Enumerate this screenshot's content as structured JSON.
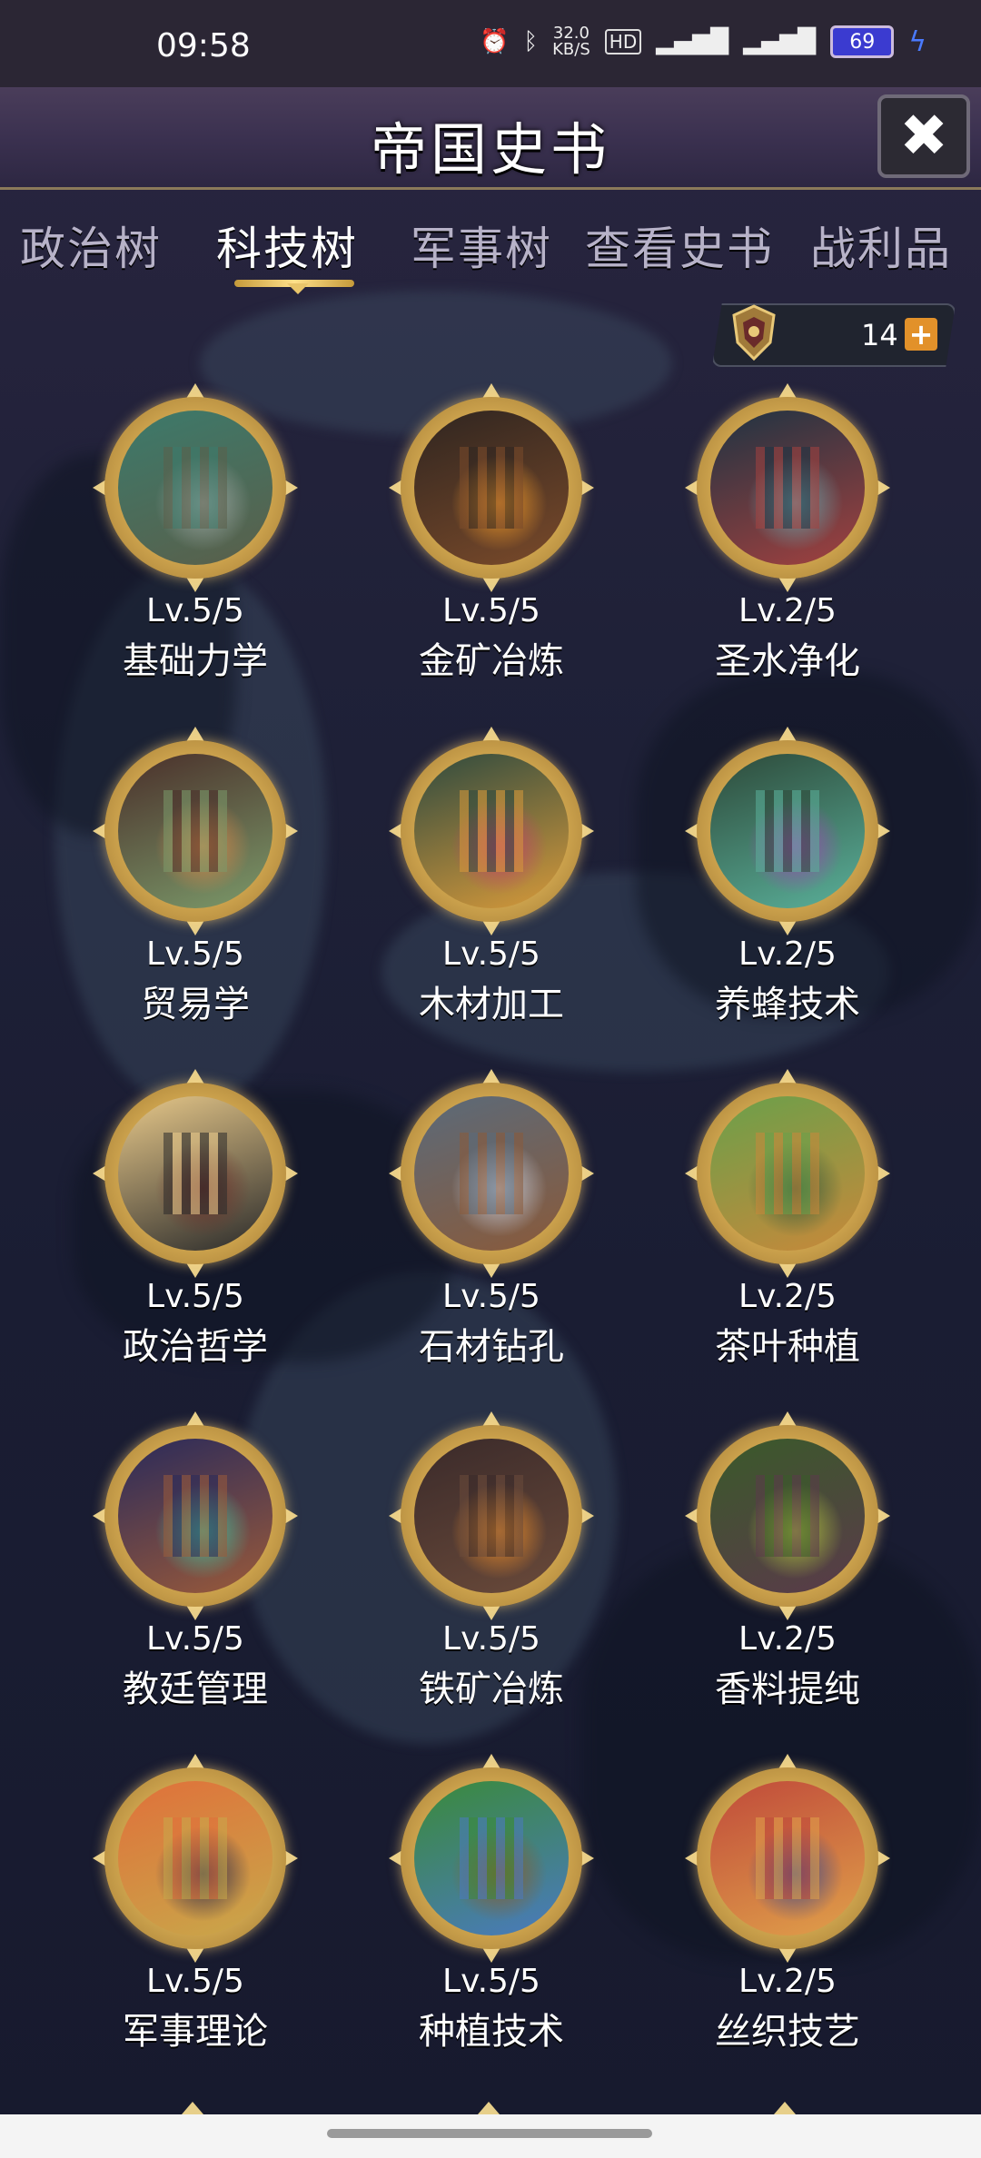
{
  "status": {
    "time": "09:58",
    "network_speed": "32.0\nKB/S",
    "battery": "69"
  },
  "header": {
    "title": "帝国史书",
    "close_label": "✖"
  },
  "tabs": [
    {
      "label": "政治树",
      "active": false
    },
    {
      "label": "科技树",
      "active": true
    },
    {
      "label": "军事树",
      "active": false
    },
    {
      "label": "查看史书",
      "active": false
    },
    {
      "label": "战利品",
      "active": false
    }
  ],
  "currency": {
    "value": "14",
    "plus": "+"
  },
  "techs": [
    {
      "level": "Lv.5/5",
      "name": "基础力学",
      "icon": "statue-icon",
      "colors": [
        "#3c7a6b",
        "#9ea7a3",
        "#5a5f4a"
      ]
    },
    {
      "level": "Lv.5/5",
      "name": "金矿冶炼",
      "icon": "forge-icon",
      "colors": [
        "#2f2520",
        "#f29b2a",
        "#7a4a2a"
      ]
    },
    {
      "level": "Lv.2/5",
      "name": "圣水净化",
      "icon": "shrine-icon",
      "colors": [
        "#1e3342",
        "#6fa0a6",
        "#a3413f"
      ]
    },
    {
      "level": "Lv.5/5",
      "name": "贸易学",
      "icon": "market-icon",
      "colors": [
        "#4a2f2a",
        "#d6884a",
        "#7b9a6a"
      ]
    },
    {
      "level": "Lv.5/5",
      "name": "木材加工",
      "icon": "forest-icon",
      "colors": [
        "#2e4a3f",
        "#c0406a",
        "#d89a3a"
      ]
    },
    {
      "level": "Lv.2/5",
      "name": "养蜂技术",
      "icon": "beehive-icon",
      "colors": [
        "#2d4a3a",
        "#9a4ab0",
        "#5ab09a"
      ]
    },
    {
      "level": "Lv.5/5",
      "name": "政治哲学",
      "icon": "philosopher-icon",
      "colors": [
        "#e8c98a",
        "#6a2f2a",
        "#2a2a2a"
      ]
    },
    {
      "level": "Lv.5/5",
      "name": "石材钻孔",
      "icon": "drill-icon",
      "colors": [
        "#5a6a7a",
        "#c8ccd8",
        "#8a5a3a"
      ]
    },
    {
      "level": "Lv.2/5",
      "name": "茶叶种植",
      "icon": "tea-plant-icon",
      "colors": [
        "#6aa04a",
        "#3a5a3a",
        "#c8883a"
      ]
    },
    {
      "level": "Lv.5/5",
      "name": "教廷管理",
      "icon": "clergy-icon",
      "colors": [
        "#2a2a5a",
        "#4ac09a",
        "#9a5a3a"
      ]
    },
    {
      "level": "Lv.5/5",
      "name": "铁矿冶炼",
      "icon": "smithy-icon",
      "colors": [
        "#3a2a2a",
        "#f0902a",
        "#6a4a3a"
      ]
    },
    {
      "level": "Lv.2/5",
      "name": "香料提纯",
      "icon": "spice-field-icon",
      "colors": [
        "#3a5a2a",
        "#b0c040",
        "#5a3a4a"
      ]
    },
    {
      "level": "Lv.5/5",
      "name": "军事理论",
      "icon": "knight-icon",
      "colors": [
        "#e0703a",
        "#2a2a4a",
        "#c8a84a"
      ]
    },
    {
      "level": "Lv.5/5",
      "name": "种植技术",
      "icon": "farmland-icon",
      "colors": [
        "#3a8a3a",
        "#8a5a2a",
        "#4a7ac0"
      ]
    },
    {
      "level": "Lv.2/5",
      "name": "丝织技艺",
      "icon": "silk-workshop-icon",
      "colors": [
        "#c04a3a",
        "#3a4a8a",
        "#e0a04a"
      ]
    }
  ]
}
